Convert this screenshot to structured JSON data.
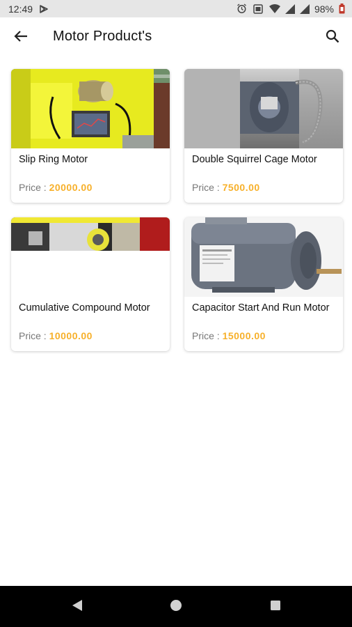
{
  "status_bar": {
    "time": "12:49",
    "battery": "98%",
    "icons": [
      "play-store-icon",
      "alarm-icon",
      "vibrate-icon",
      "wifi-icon",
      "signal-icon",
      "battery-icon"
    ]
  },
  "app_bar": {
    "title": "Motor Product's",
    "icons": [
      "back-arrow-icon",
      "search-icon"
    ]
  },
  "products": [
    {
      "name": "Slip Ring Motor",
      "price_label": "Price : ",
      "price": "20000.00"
    },
    {
      "name": "Double Squirrel Cage Motor",
      "price_label": "Price : ",
      "price": "7500.00"
    },
    {
      "name": "Cumulative Compound Motor",
      "price_label": "Price : ",
      "price": "10000.00"
    },
    {
      "name": "Capacitor Start And Run Motor",
      "price_label": "Price : ",
      "price": "15000.00"
    }
  ],
  "nav_bar": {
    "icons": [
      "back-triangle-icon",
      "home-circle-icon",
      "recents-square-icon"
    ]
  },
  "colors": {
    "price_accent": "#f7b02a",
    "status_bar_bg": "#e6e6e6",
    "nav_bar_bg": "#000000"
  }
}
